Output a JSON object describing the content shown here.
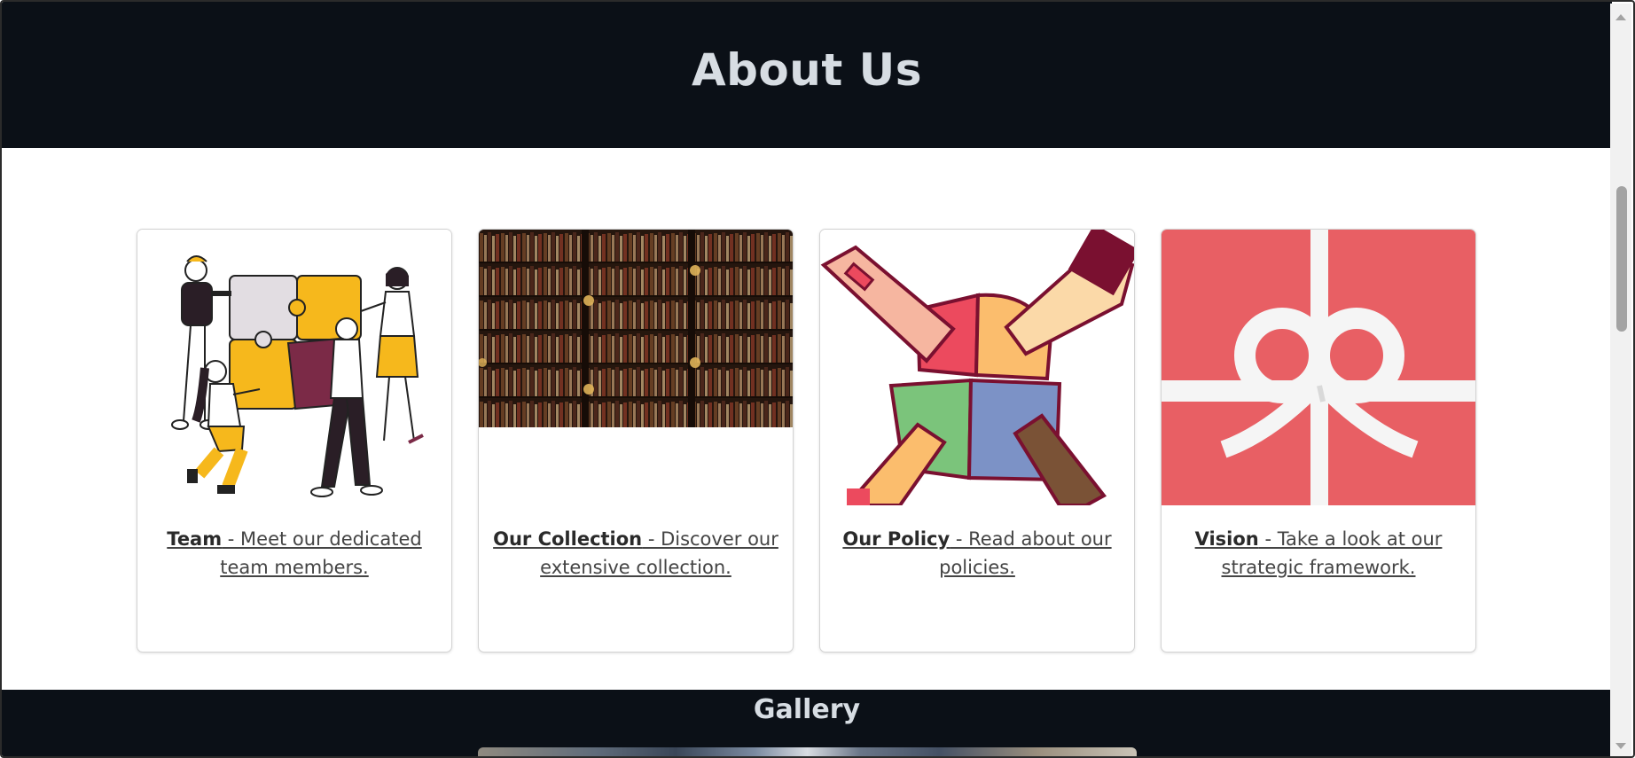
{
  "hero": {
    "title": "About Us"
  },
  "cards": [
    {
      "bold": "Team",
      "rest": " - Meet our dedicated team members.",
      "image_icon": "puzzle-team-illustration"
    },
    {
      "bold": "Our Collection",
      "rest": " - Discover our extensive collection.",
      "image_icon": "bookshelf-photo"
    },
    {
      "bold": "Our Policy",
      "rest": " - Read about our policies.",
      "image_icon": "hands-puzzle-illustration"
    },
    {
      "bold": "Vision",
      "rest": " - Take a look at our strategic framework.",
      "image_icon": "gift-ribbon-illustration"
    }
  ],
  "gallery": {
    "title": "Gallery"
  },
  "colors": {
    "header_bg": "#0b1017",
    "header_text": "#d7dde3",
    "gift_red": "#e85f64",
    "puzzle_yellow": "#f6b81c",
    "puzzle_maroon": "#7b2a47"
  }
}
